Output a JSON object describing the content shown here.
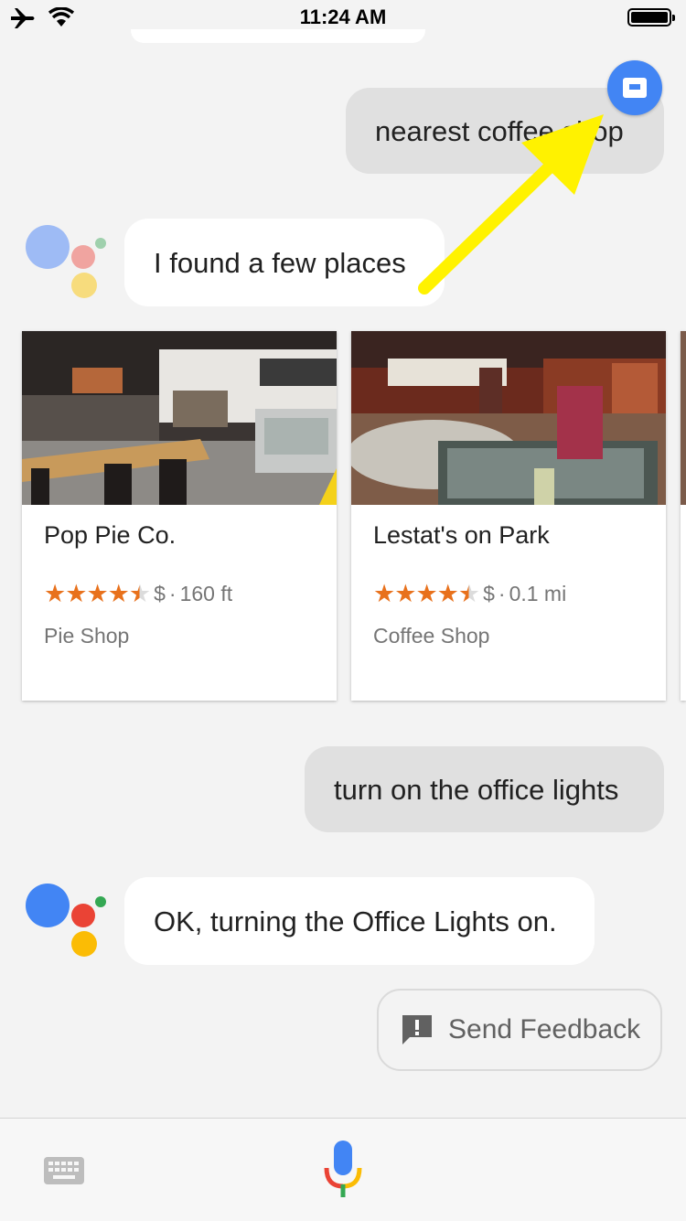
{
  "status_bar": {
    "time": "11:24 AM"
  },
  "conversation": {
    "query1": "nearest coffee shop",
    "response1": "I found a few places",
    "query2": "turn on the office lights",
    "response2": "OK, turning the Office Lights on."
  },
  "places": [
    {
      "name": "Pop Pie Co.",
      "rating": 4.5,
      "price": "$",
      "distance": "160 ft",
      "category": "Pie Shop"
    },
    {
      "name": "Lestat's on Park",
      "rating": 4.5,
      "price": "$",
      "distance": "0.1 mi",
      "category": "Coffee Shop"
    }
  ],
  "feedback": {
    "label": "Send Feedback"
  },
  "colors": {
    "google_blue": "#4285f4",
    "google_red": "#ea4335",
    "google_yellow": "#fbbc05",
    "google_green": "#34a853",
    "star_orange": "#e8711c",
    "annotation_arrow": "#fff200"
  },
  "icons": [
    "airplane-icon",
    "wifi-icon",
    "battery-icon",
    "assistant-logo-icon",
    "keyboard-icon",
    "microphone-icon",
    "feedback-icon"
  ]
}
